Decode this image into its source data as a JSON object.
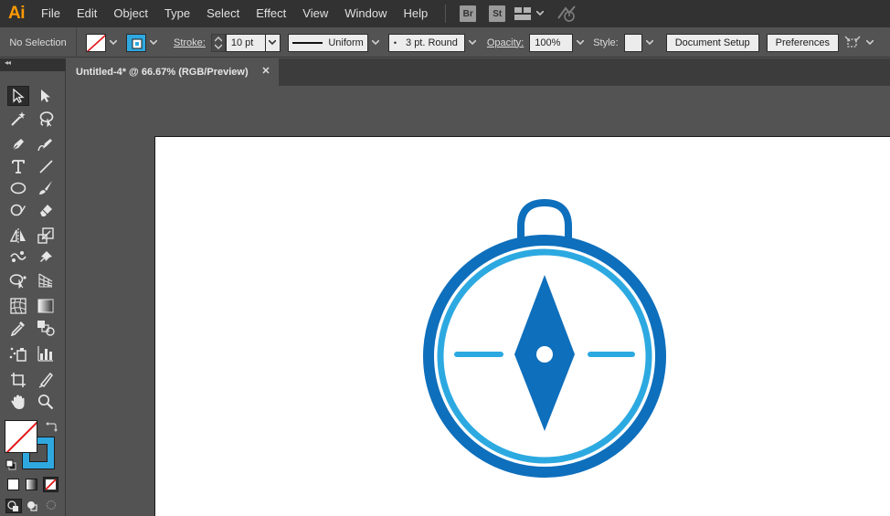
{
  "app": {
    "logo_text": "Ai"
  },
  "menu": {
    "items": [
      "File",
      "Edit",
      "Object",
      "Type",
      "Select",
      "Effect",
      "View",
      "Window",
      "Help"
    ],
    "bridge_badge": "Br",
    "stock_badge": "St"
  },
  "control_bar": {
    "selection_label": "No Selection",
    "stroke_label": "Stroke:",
    "stroke_value": "10 pt",
    "profile_label": "Uniform",
    "brush_label": "3 pt. Round",
    "opacity_label": "Opacity:",
    "opacity_value": "100%",
    "style_label": "Style:",
    "document_setup": "Document Setup",
    "preferences": "Preferences"
  },
  "document": {
    "tab_title": "Untitled-4* @ 66.67% (RGB/Preview)",
    "close_glyph": "✕"
  },
  "toolbox": {
    "collapse_glyph": "◂◂",
    "tools": [
      "selection-tool",
      "direct-selection-tool",
      "magic-wand-tool",
      "lasso-tool",
      "pen-tool",
      "curvature-tool",
      "type-tool",
      "line-segment-tool",
      "ellipse-tool",
      "paintbrush-tool",
      "shaper-tool",
      "eraser-tool",
      "reflect-tool",
      "scale-tool",
      "puppet-warp-tool",
      "pin-tool",
      "shape-builder-tool",
      "perspective-grid-tool",
      "mesh-tool",
      "gradient-tool",
      "eyedropper-tool",
      "blend-tool",
      "symbol-sprayer-tool",
      "column-graph-tool",
      "artboard-tool",
      "slice-tool",
      "hand-tool",
      "zoom-tool"
    ],
    "selected_tool": "selection-tool"
  },
  "colors": {
    "fill": "none",
    "stroke": "#2fa8e0",
    "compass_dark": "#0e6fbc",
    "compass_light": "#2da9e1",
    "brand": "#ff9a00"
  }
}
